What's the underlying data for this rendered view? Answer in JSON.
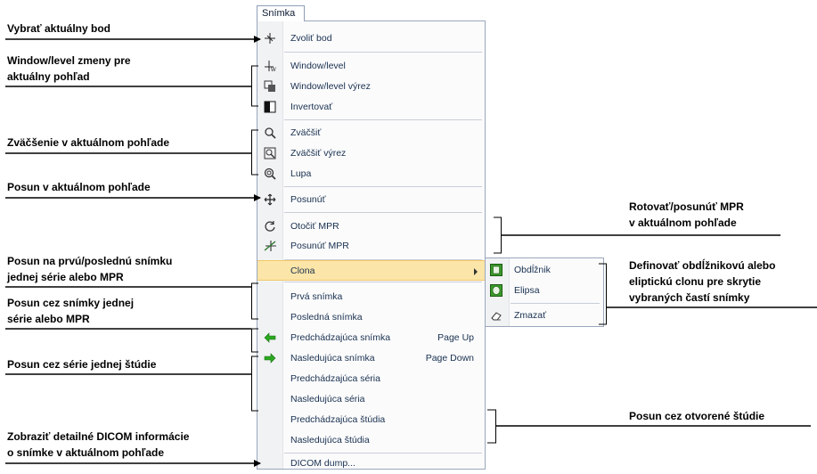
{
  "menu_title": "Snímka",
  "menu_items": {
    "select_point": "Zvoliť bod",
    "window_level": "Window/level",
    "window_level_region": "Window/level výrez",
    "invert": "Invertovať",
    "zoom": "Zväčšiť",
    "zoom_region": "Zväčšiť výrez",
    "magnifier": "Lupa",
    "pan": "Posunúť",
    "rotate_mpr": "Otočiť MPR",
    "move_mpr": "Posunúť MPR",
    "shutter": "Clona",
    "first_image": "Prvá snímka",
    "last_image": "Posledná snímka",
    "prev_image": "Predchádzajúca snímka",
    "prev_image_shortcut": "Page Up",
    "next_image": "Nasledujúca snímka",
    "next_image_shortcut": "Page Down",
    "prev_series": "Predchádzajúca séria",
    "next_series": "Nasledujúca séria",
    "prev_study": "Predchádzajúca štúdia",
    "next_study": "Nasledujúca štúdia",
    "dicom_dump": "DICOM dump..."
  },
  "submenu_items": {
    "rectangle": "Obdĺžnik",
    "ellipse": "Elipsa",
    "delete": "Zmazať"
  },
  "annotations": {
    "select_point": "Vybrať aktuálny bod",
    "window_level_1": "Window/level zmeny pre",
    "window_level_2": "aktuálny pohľad",
    "zoom": "Zväčšenie v aktuálnom pohľade",
    "pan": "Posun v aktuálnom pohľade",
    "first_last_1": "Posun na prvú/poslednú snímku",
    "first_last_2": "jednej série alebo MPR",
    "images_1": "Posun cez snímky jednej",
    "images_2": "série alebo MPR",
    "series": "Posun cez série jednej štúdie",
    "dicom_1": "Zobraziť detailné DICOM informácie",
    "dicom_2": "o snímke v aktuálnom pohľade",
    "mpr_1": "Rotovať/posunúť MPR",
    "mpr_2": "v aktuálnom pohľade",
    "shutter_1": "Definovať obdĺžnikovú alebo",
    "shutter_2": "eliptickú clonu pre skrytie",
    "shutter_3": "vybraných častí snímky",
    "studies": "Posun cez otvorené štúdie"
  },
  "colors": {
    "highlight": "#fce5a8",
    "menu_text": "#18304f",
    "arrow_green": "#2aa81f",
    "icon_green": "#3a9a2a"
  }
}
